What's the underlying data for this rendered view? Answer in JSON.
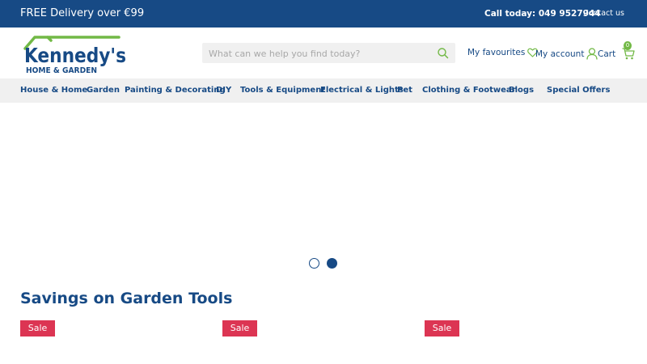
{
  "topbar": {
    "promo": "FREE Delivery over €99",
    "call": "Call today: 049 9527944",
    "contact": "Contact us"
  },
  "logo": {
    "line1": "Kennedy's",
    "line2": "HOME & GARDEN"
  },
  "search": {
    "placeholder": "What can we help you find today?",
    "icon": "search-icon"
  },
  "header_links": {
    "favourites": "My favourites",
    "account": "My account",
    "cart": "Cart",
    "cart_count": "0"
  },
  "nav": {
    "items": [
      "House & Home",
      "Garden",
      "Painting & Decorating",
      "DIY",
      "Tools & Equipment",
      "Electrical & Lights",
      "Pet",
      "Clothing & Footwear",
      "Blogs",
      "Special Offers"
    ]
  },
  "carousel": {
    "slide_count": 2,
    "active_index": 1
  },
  "section": {
    "title": "Savings on Garden Tools",
    "badges": [
      "Sale",
      "Sale",
      "Sale"
    ]
  },
  "colors": {
    "brand_blue": "#174a85",
    "brand_green": "#72b946",
    "sale_red": "#dc3553",
    "nav_bg": "#f0f0f0"
  }
}
